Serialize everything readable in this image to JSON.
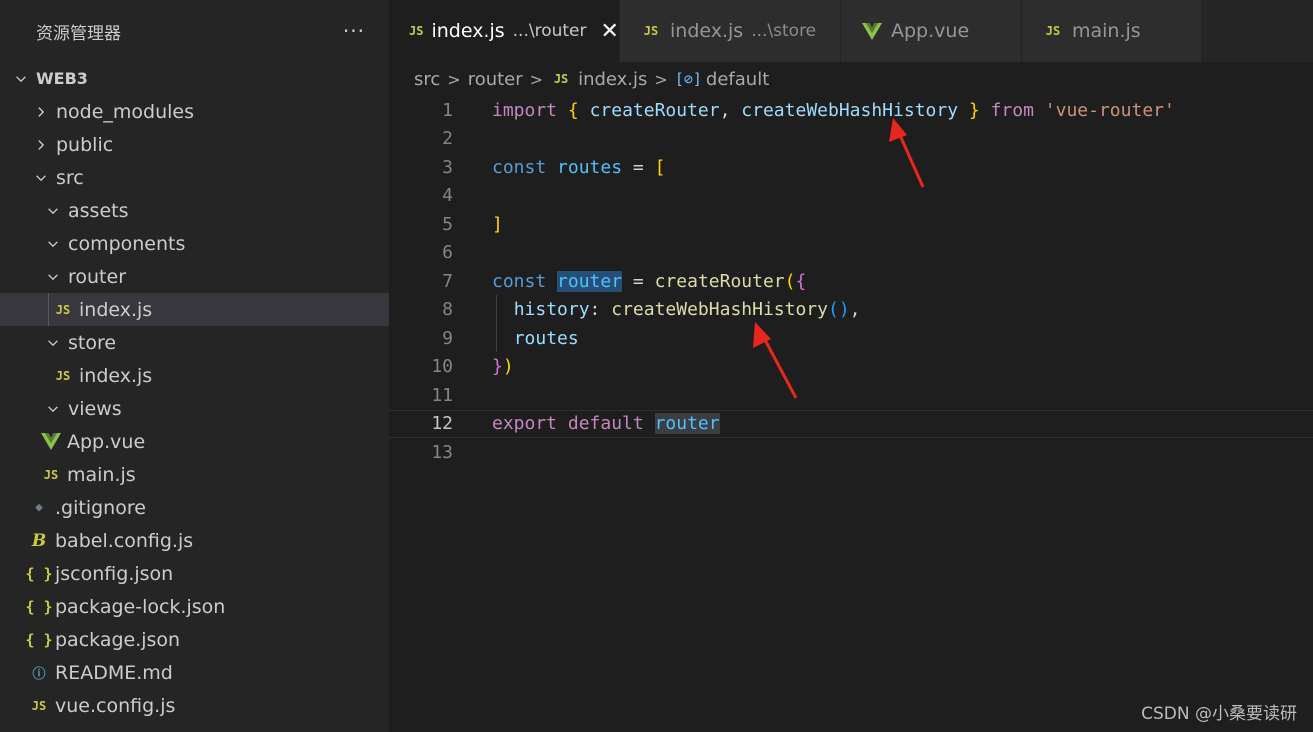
{
  "explorer": {
    "title": "资源管理器",
    "more": "···",
    "root": "WEB3",
    "items": [
      {
        "label": "node_modules"
      },
      {
        "label": "public"
      },
      {
        "label": "src"
      },
      {
        "label": "assets"
      },
      {
        "label": "components"
      },
      {
        "label": "router"
      },
      {
        "label": "index.js"
      },
      {
        "label": "store"
      },
      {
        "label": "index.js"
      },
      {
        "label": "views"
      },
      {
        "label": "App.vue"
      },
      {
        "label": "main.js"
      },
      {
        "label": ".gitignore"
      },
      {
        "label": "babel.config.js"
      },
      {
        "label": "jsconfig.json"
      },
      {
        "label": "package-lock.json"
      },
      {
        "label": "package.json"
      },
      {
        "label": "README.md"
      },
      {
        "label": "vue.config.js"
      }
    ]
  },
  "icons": {
    "js": "JS",
    "json": "{ }",
    "info": "ⓘ",
    "babel": "B",
    "git": "◆",
    "close": "✕",
    "symbol": "[⊘]"
  },
  "tabs": [
    {
      "name": "index.js",
      "desc": "...\\router"
    },
    {
      "name": "index.js",
      "desc": "...\\store"
    },
    {
      "name": "App.vue",
      "desc": ""
    },
    {
      "name": "main.js",
      "desc": ""
    }
  ],
  "breadcrumb": {
    "src": "src",
    "router": "router",
    "file": "index.js",
    "symbol": "default",
    "sep": ">"
  },
  "editor": {
    "line_numbers": [
      "1",
      "2",
      "3",
      "4",
      "5",
      "6",
      "7",
      "8",
      "9",
      "10",
      "11",
      "12",
      "13"
    ],
    "t": {
      "import": "import",
      "lb": "{",
      "createRouter": "createRouter",
      "comma": ",",
      "createWebHashHistory": "createWebHashHistory",
      "rb": "}",
      "from": "from",
      "mod": "'vue-router'",
      "const": "const",
      "routes": "routes",
      "eq": "=",
      "lsq": "[",
      "rsq": "]",
      "router": "router",
      "lp": "(",
      "history": "history",
      "colon": ":",
      "call": "()",
      "rp": ")",
      "export": "export",
      "default": "default"
    }
  },
  "watermark": "CSDN @小桑要读研",
  "colors": {
    "background": "#1e1e1e",
    "sidebar": "#252526",
    "keyword": "#c586c0",
    "function": "#dcdcaa",
    "string": "#ce9178",
    "arrow": "#e8271c"
  }
}
